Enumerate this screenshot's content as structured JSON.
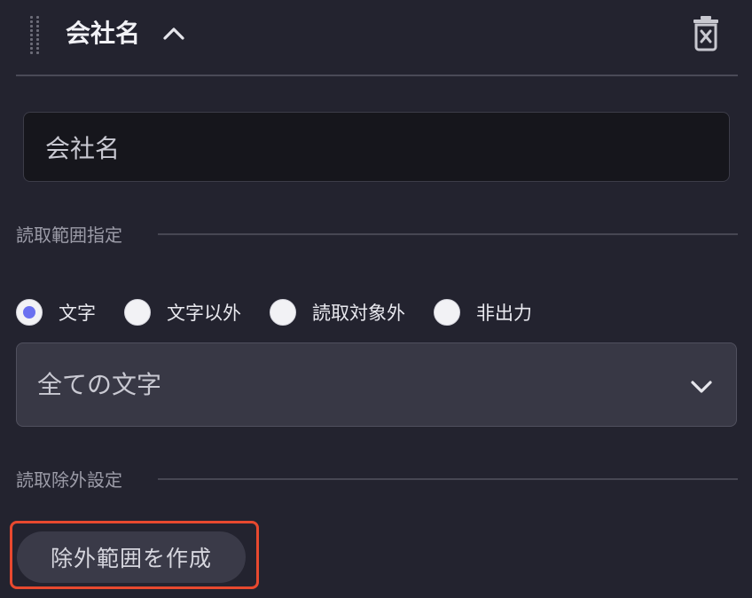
{
  "header": {
    "title": "会社名",
    "drag_icon": "drag-handle-icon",
    "collapse_icon": "chevron-up-icon",
    "delete_icon": "trash-icon"
  },
  "name_field": {
    "value": "会社名"
  },
  "read_range": {
    "section_title": "読取範囲指定",
    "options": [
      {
        "label": "文字",
        "checked": true
      },
      {
        "label": "文字以外",
        "checked": false
      },
      {
        "label": "読取対象外",
        "checked": false
      },
      {
        "label": "非出力",
        "checked": false
      }
    ],
    "select_value": "全ての文字",
    "select_icon": "chevron-down-icon"
  },
  "read_exclusion": {
    "section_title": "読取除外設定",
    "create_button_label": "除外範囲を作成"
  },
  "colors": {
    "background": "#23232f",
    "radio_selected": "#6a70f0",
    "highlight": "#e8492f"
  }
}
